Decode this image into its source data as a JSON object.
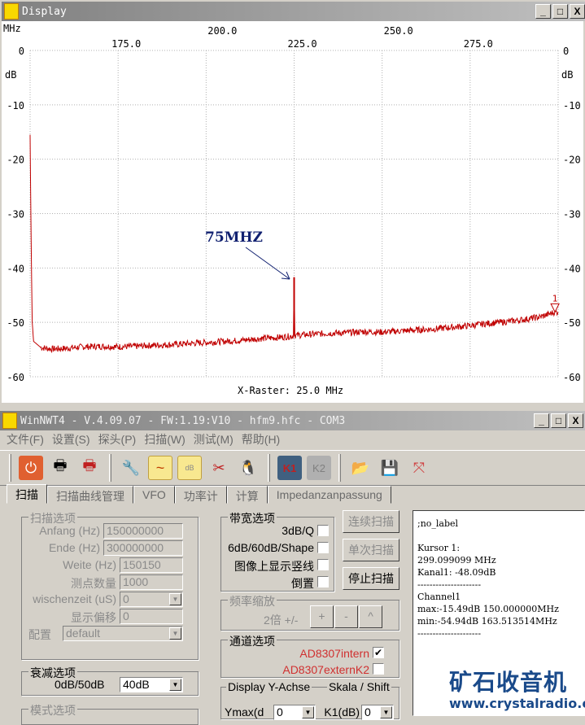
{
  "display": {
    "title": "Display",
    "x_unit": "MHz",
    "y_unit": "dB",
    "x_raster": "X-Raster: 25.0 MHz",
    "annotation": "75MHZ",
    "cursor_label": "1"
  },
  "chart_data": {
    "type": "line",
    "title": "Display",
    "xlabel": "MHz",
    "ylabel": "dB",
    "xlim": [
      150,
      300
    ],
    "ylim": [
      -60,
      0
    ],
    "x_ticks_top": [
      "200.0",
      "250.0"
    ],
    "x_ticks_bottom": [
      "175.0",
      "225.0",
      "275.0"
    ],
    "x_tick_values_top": [
      200,
      250
    ],
    "x_tick_values_bottom": [
      175,
      225,
      275
    ],
    "y_ticks": [
      "0",
      "-10",
      "-20",
      "-30",
      "-40",
      "-50",
      "-60"
    ],
    "y_tick_values": [
      0,
      -10,
      -20,
      -30,
      -40,
      -50,
      -60
    ],
    "grid": true,
    "series": [
      {
        "name": "Channel1",
        "color": "#c00000",
        "x": [
          150,
          150.3,
          150.6,
          151,
          153,
          156,
          160,
          165,
          170,
          175,
          180,
          185,
          190,
          195,
          200,
          205,
          210,
          215,
          220,
          224.8,
          225,
          225.2,
          230,
          235,
          240,
          245,
          250,
          255,
          260,
          265,
          270,
          275,
          280,
          285,
          290,
          295,
          299.1,
          300
        ],
        "y": [
          -15.5,
          -35,
          -50,
          -53.5,
          -54.6,
          -54.9,
          -54.8,
          -54.5,
          -54.4,
          -54.5,
          -54.4,
          -54.2,
          -54.1,
          -53.9,
          -53.7,
          -53.5,
          -53.3,
          -53,
          -52.8,
          -52.5,
          -41.7,
          -52.4,
          -52.2,
          -52,
          -51.9,
          -51.7,
          -51.8,
          -51.6,
          -51.4,
          -51.2,
          -50.9,
          -50.6,
          -50.2,
          -49.9,
          -49.5,
          -49,
          -48.1,
          -48.1
        ]
      }
    ],
    "annotations": [
      {
        "text": "75MHZ",
        "x": 225,
        "y": -41.7
      }
    ],
    "cursor": {
      "label": "1",
      "x": 299.1,
      "y": -48.09
    }
  },
  "main": {
    "title": "WinNWT4 - V.4.09.07 - FW:1.19:V10 - hfm9.hfc - COM3",
    "menu": [
      "文件(F)",
      "设置(S)",
      "探头(P)",
      "扫描(W)",
      "测试(M)",
      "帮助(H)"
    ],
    "tabs": [
      "扫描",
      "扫描曲线管理",
      "VFO",
      "功率计",
      "计算",
      "Impedanzanpassung"
    ],
    "scan_options": {
      "title": "扫描选项",
      "fields": [
        {
          "label": "Anfang (Hz)",
          "value": "150000000"
        },
        {
          "label": "Ende (Hz)",
          "value": "300000000"
        },
        {
          "label": "Weite (Hz)",
          "value": "150150"
        },
        {
          "label": "测点数量",
          "value": "1000"
        },
        {
          "label": "wischenzeit (uS)",
          "value": "0"
        },
        {
          "label": "显示偏移",
          "value": "0"
        },
        {
          "label": "配置",
          "value": "default"
        }
      ]
    },
    "atten": {
      "title": "衰减选项",
      "label": "0dB/50dB",
      "value": "40dB"
    },
    "mode": {
      "title": "模式选项"
    },
    "bandwidth": {
      "title": "带宽选项",
      "items": [
        {
          "label": "3dB/Q",
          "checked": false
        },
        {
          "label": "6dB/60dB/Shape",
          "checked": false
        },
        {
          "label": "图像上显示竖线",
          "checked": false
        },
        {
          "label": "倒置",
          "checked": false
        }
      ]
    },
    "buttons": {
      "continuous": "连续扫描",
      "single": "单次扫描",
      "stop": "停止扫描"
    },
    "zoom": {
      "title": "频率缩放",
      "label": "2倍 +/-",
      "plus": "+",
      "minus": "-",
      "up": "^"
    },
    "channel": {
      "title": "通道选项",
      "items": [
        {
          "label": "AD8307intern",
          "checked": true,
          "mark": "✔"
        },
        {
          "label": "AD8307externK2",
          "checked": false
        }
      ]
    },
    "yaxis": {
      "title": "Display Y-Achse",
      "title2": "Skala / Shift",
      "ymax_label": "Ymax(d",
      "ymax_value": "0",
      "k1_label": "K1(dB)",
      "k1_value": "0"
    },
    "info": ";no_label\n\nKursor 1:\n299.099099 MHz\nKanal1: -48.09dB\n---------------------\nChannel1\nmax:-15.49dB 150.000000MHz\nmin:-54.94dB 163.513514MHz\n---------------------",
    "watermark": {
      "cn": "矿石收音机",
      "url": "www.crystalradio.cn"
    }
  }
}
